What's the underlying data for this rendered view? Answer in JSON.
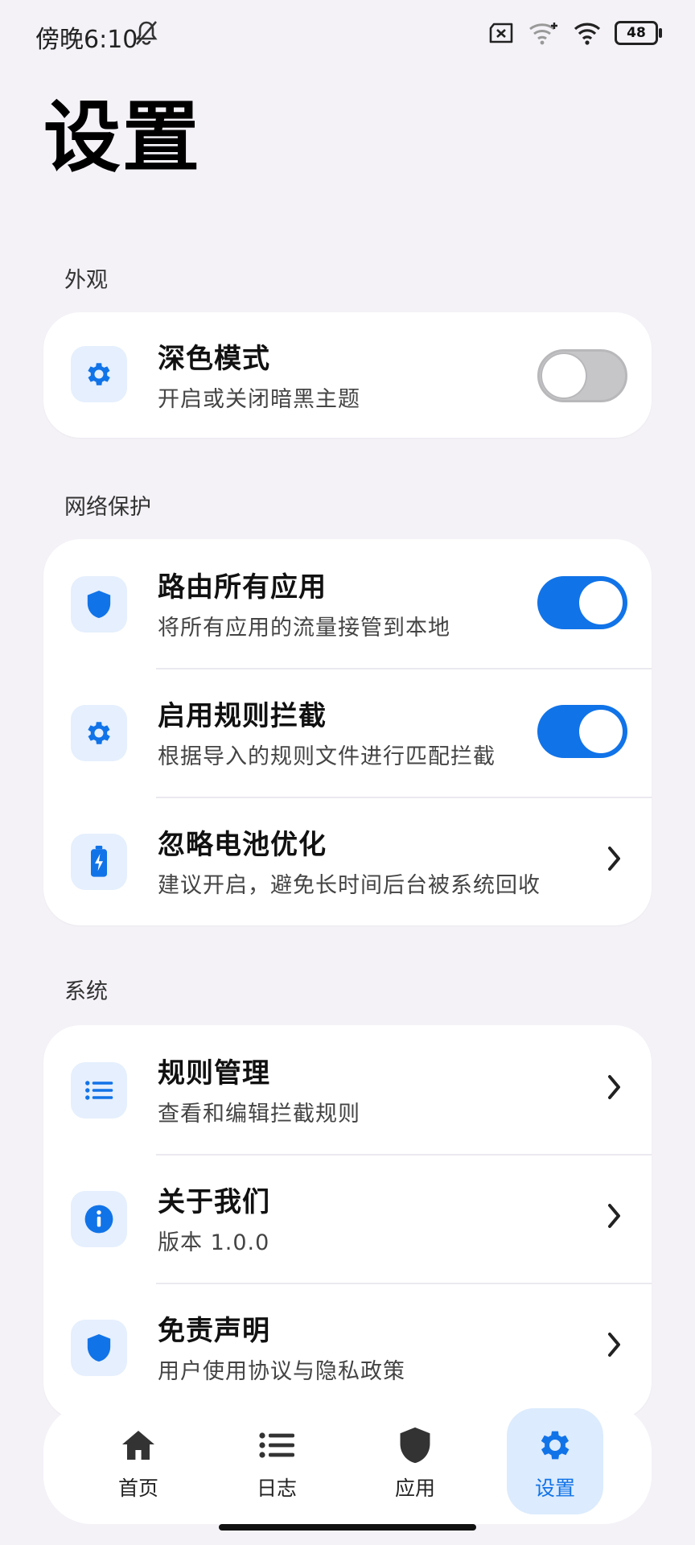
{
  "status_bar": {
    "time": "傍晚6:10",
    "battery": "48"
  },
  "page": {
    "title": "设置"
  },
  "sections": [
    {
      "title": "外观",
      "items": [
        {
          "title": "深色模式",
          "subtitle": "开启或关闭暗黑主题",
          "icon": "gear-icon",
          "control": "toggle",
          "enabled": false
        }
      ]
    },
    {
      "title": "网络保护",
      "items": [
        {
          "title": "路由所有应用",
          "subtitle": "将所有应用的流量接管到本地",
          "icon": "shield-icon",
          "control": "toggle",
          "enabled": true
        },
        {
          "title": "启用规则拦截",
          "subtitle": "根据导入的规则文件进行匹配拦截",
          "icon": "gear-icon",
          "control": "toggle",
          "enabled": true
        },
        {
          "title": "忽略电池优化",
          "subtitle": "建议开启，避免长时间后台被系统回收",
          "icon": "battery-charging-icon",
          "control": "chevron"
        }
      ]
    },
    {
      "title": "系统",
      "items": [
        {
          "title": "规则管理",
          "subtitle": "查看和编辑拦截规则",
          "icon": "list-icon",
          "control": "chevron"
        },
        {
          "title": "关于我们",
          "subtitle": "版本 1.0.0",
          "icon": "info-icon",
          "control": "chevron"
        },
        {
          "title": "免责声明",
          "subtitle": "用户使用协议与隐私政策",
          "icon": "shield-icon",
          "control": "chevron"
        }
      ]
    }
  ],
  "bottom_nav": [
    {
      "label": "首页",
      "icon": "home-icon",
      "active": false
    },
    {
      "label": "日志",
      "icon": "list-icon",
      "active": false
    },
    {
      "label": "应用",
      "icon": "shield-icon",
      "active": false
    },
    {
      "label": "设置",
      "icon": "gear-icon",
      "active": true
    }
  ],
  "colors": {
    "accent": "#1173e8",
    "icon_bg": "#e5effd",
    "background": "#f4f2f7",
    "toggle_off": "#c6c6c9"
  }
}
